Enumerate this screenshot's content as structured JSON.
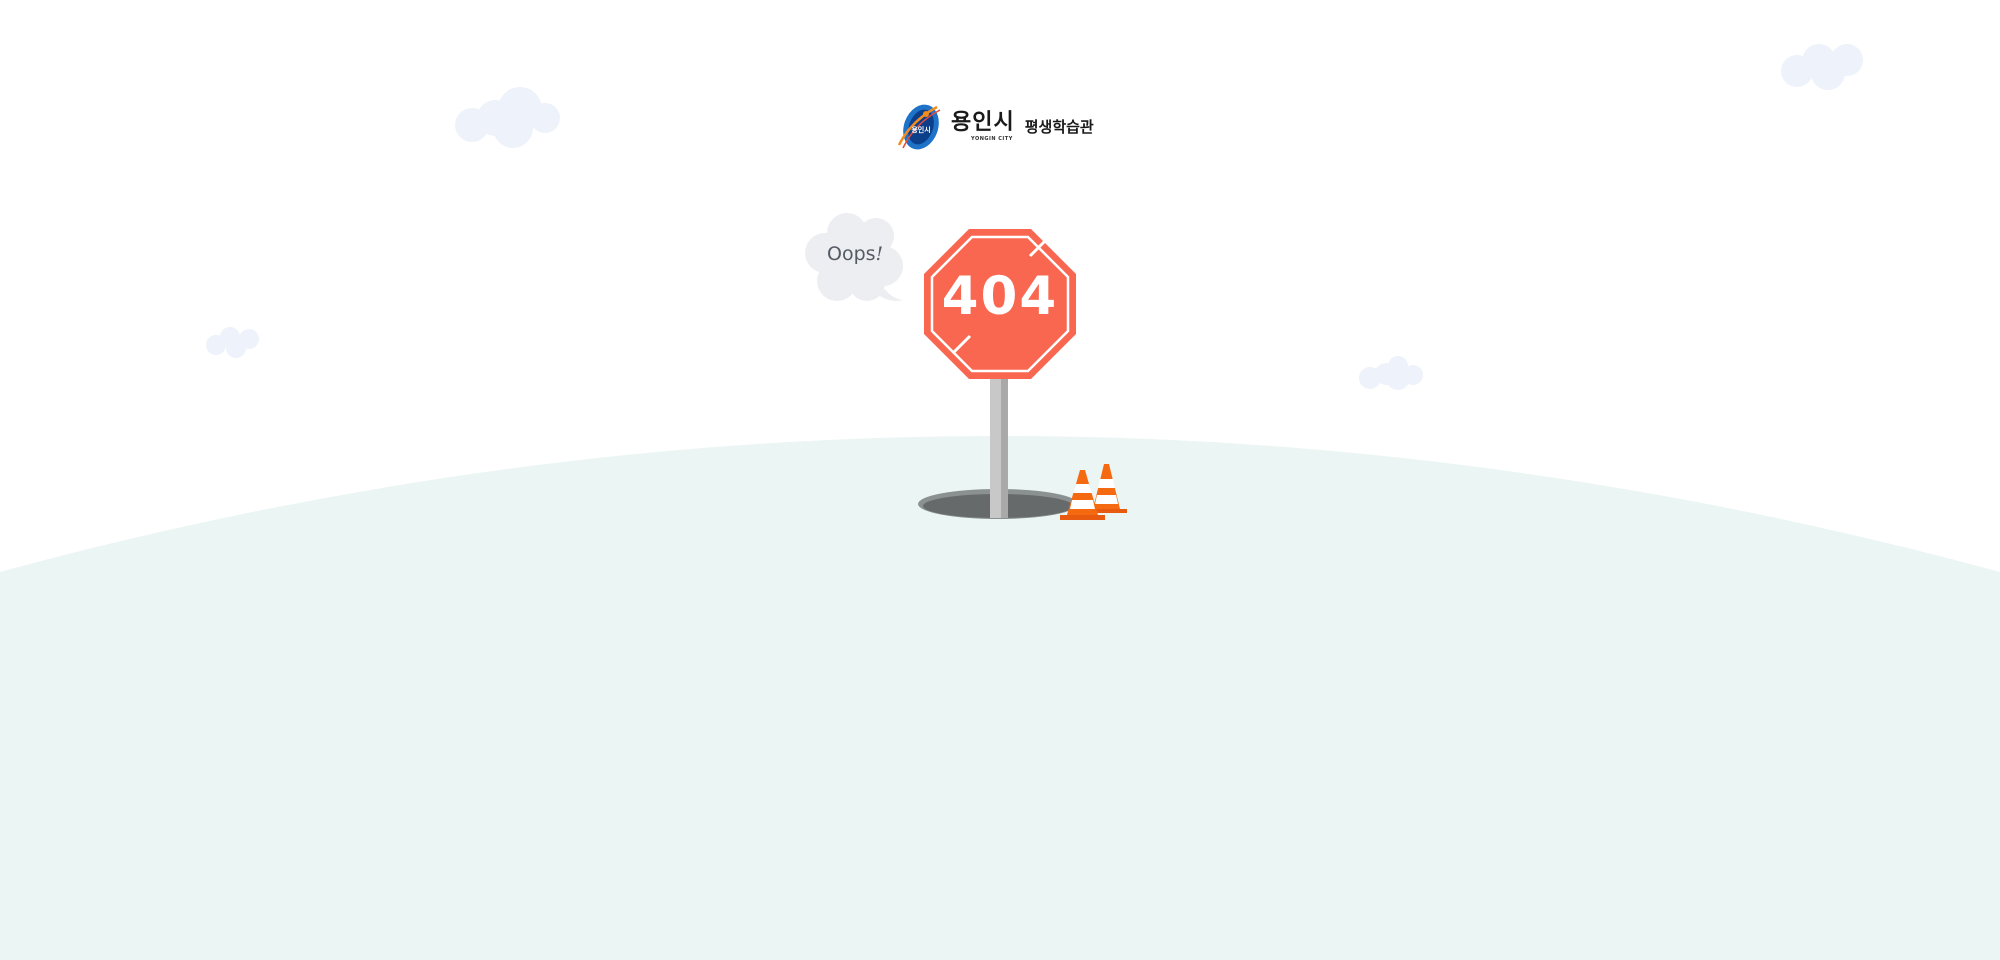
{
  "logo": {
    "city_name": "용인시",
    "city_name_en": "YONGIN CITY",
    "emblem_text": "용인시",
    "subtitle": "평생학습관"
  },
  "speech_bubble": {
    "text": "Oops",
    "punctuation": "!"
  },
  "sign": {
    "code": "404",
    "color": "#fa6751"
  },
  "colors": {
    "ground": "#ebf5f3",
    "clouds": "#eef2fa",
    "bubble": "#eceef2",
    "pole": "#c8c8c8",
    "hole": "#666a6a",
    "cone_orange": "#f56a10"
  }
}
